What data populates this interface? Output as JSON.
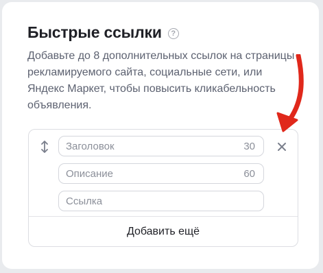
{
  "section": {
    "title": "Быстрые ссылки",
    "help_icon_glyph": "?",
    "description": "Добавьте до 8 дополнительных ссылок на страницы рекламируемого сайта, социальные сети, или Яндекс Маркет, чтобы повысить кликабельность объявления."
  },
  "quick_link": {
    "title_field": {
      "placeholder": "Заголовок",
      "max_length": "30"
    },
    "description_field": {
      "placeholder": "Описание",
      "max_length": "60"
    },
    "url_field": {
      "placeholder": "Ссылка"
    }
  },
  "add_more_label": "Добавить ещё",
  "icons": {
    "drag": "drag-vertical-icon",
    "close": "close-icon",
    "help": "question-circle-icon",
    "annotation": "red-arrow-annotation"
  },
  "colors": {
    "annotation_arrow": "#e0281b",
    "text_primary": "#1f2026",
    "text_secondary": "#5c6170"
  }
}
